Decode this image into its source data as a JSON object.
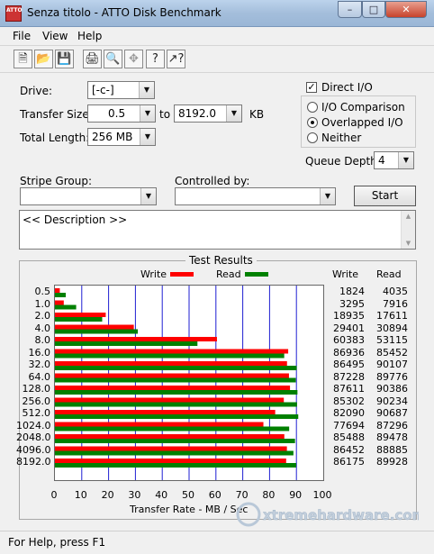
{
  "window": {
    "title": "Senza titolo - ATTO Disk Benchmark",
    "app_icon_text": "ATTO"
  },
  "menu": {
    "file": "File",
    "view": "View",
    "help": "Help"
  },
  "settings": {
    "drive_label": "Drive:",
    "drive_value": "[-c-]",
    "transfer_size_label": "Transfer Size:",
    "transfer_from": "0.5",
    "to_label": "to",
    "transfer_to": "8192.0",
    "unit": "KB",
    "total_length_label": "Total Length:",
    "total_length_value": "256 MB",
    "direct_io_label": "Direct I/O",
    "direct_io_checked": true,
    "io_comparison_label": "I/O Comparison",
    "overlapped_io_label": "Overlapped I/O",
    "neither_label": "Neither",
    "selected_mode": "overlapped",
    "queue_depth_label": "Queue Depth:",
    "queue_depth_value": "4",
    "stripe_group_label": "Stripe Group:",
    "controlled_by_label": "Controlled by:",
    "start_label": "Start",
    "description_text": "<< Description >>"
  },
  "results": {
    "group_label": "Test Results",
    "legend_write": "Write",
    "legend_read": "Read",
    "col_write": "Write",
    "col_read": "Read",
    "write_color": "#ff0000",
    "read_color": "#008000",
    "rows_write": [
      "1824",
      "3295",
      "18935",
      "29401",
      "60383",
      "86936",
      "86495",
      "87228",
      "87611",
      "85302",
      "82090",
      "77694",
      "85488",
      "86452",
      "86175"
    ],
    "rows_read": [
      "4035",
      "7916",
      "17611",
      "30894",
      "53115",
      "85452",
      "90107",
      "89776",
      "90386",
      "90234",
      "90687",
      "87296",
      "89478",
      "88885",
      "89928"
    ]
  },
  "chart_data": {
    "type": "bar",
    "orientation": "horizontal",
    "categories": [
      "0.5",
      "1.0",
      "2.0",
      "4.0",
      "8.0",
      "16.0",
      "32.0",
      "64.0",
      "128.0",
      "256.0",
      "512.0",
      "1024.0",
      "2048.0",
      "4096.0",
      "8192.0"
    ],
    "series": [
      {
        "name": "Write",
        "values": [
          1.824,
          3.295,
          18.935,
          29.401,
          60.383,
          86.936,
          86.495,
          87.228,
          87.611,
          85.302,
          82.09,
          77.694,
          85.488,
          86.452,
          86.175
        ]
      },
      {
        "name": "Read",
        "values": [
          4.035,
          7.916,
          17.611,
          30.894,
          53.115,
          85.452,
          90.107,
          89.776,
          90.386,
          90.234,
          90.687,
          87.296,
          89.478,
          88.885,
          89.928
        ]
      }
    ],
    "xlabel": "Transfer Rate - MB / Sec",
    "xlim": [
      0,
      100
    ],
    "xticks": [
      "0",
      "10",
      "20",
      "30",
      "40",
      "50",
      "60",
      "70",
      "80",
      "90",
      "100"
    ],
    "grid": true
  },
  "status": {
    "text": "For Help, press F1",
    "watermark": "xtremehardware.com"
  }
}
